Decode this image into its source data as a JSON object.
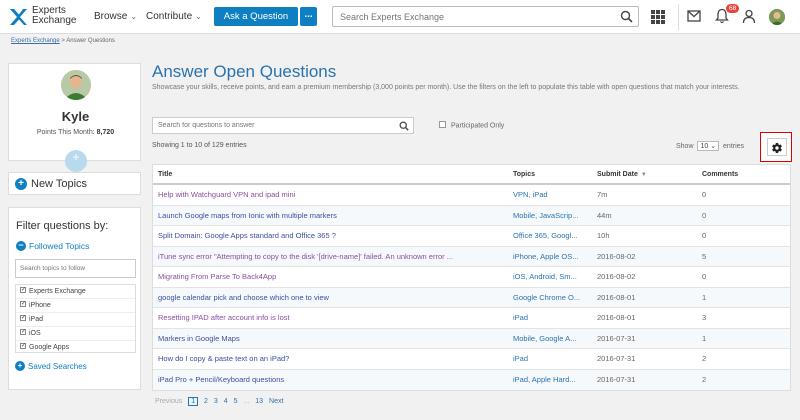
{
  "header": {
    "logo_line1": "Experts",
    "logo_line2": "Exchange",
    "nav_browse": "Browse",
    "nav_contribute": "Contribute",
    "ask_button": "Ask a Question",
    "more_button": "...",
    "search_placeholder": "Search Experts Exchange",
    "notification_count": "68",
    "accent_color": "#0e7fc1"
  },
  "breadcrumb": {
    "home": "Experts Exchange",
    "separator": ">",
    "current": "Answer Questions"
  },
  "profile": {
    "name": "Kyle",
    "points_label": "Points This Month:",
    "points_value": "8,720"
  },
  "sidebar": {
    "new_topics": "New Topics",
    "filter_title": "Filter questions by:",
    "followed_topics": "Followed Topics",
    "topic_search_placeholder": "Search topics to follow",
    "topics": [
      {
        "label": "Experts Exchange",
        "checked": true
      },
      {
        "label": "iPhone",
        "checked": true
      },
      {
        "label": "iPad",
        "checked": true
      },
      {
        "label": "iOS",
        "checked": true
      },
      {
        "label": "Google Apps",
        "checked": true
      }
    ],
    "saved_searches": "Saved Searches"
  },
  "main": {
    "title": "Answer Open Questions",
    "description": "Showcase your skills, receive points, and earn a premium membership (3,000 points per month). Use the filters on the left to populate this table with open questions that match your interests.",
    "search_placeholder": "Search for questions to answer",
    "participated_label": "Participated Only",
    "showing": "Showing 1 to 10 of 129 entries",
    "show_label": "Show",
    "show_value": "10",
    "entries_label": "entries"
  },
  "table": {
    "headers": {
      "title": "Title",
      "topics": "Topics",
      "submit_date": "Submit Date",
      "comments": "Comments"
    },
    "rows": [
      {
        "title": "Help with Watchguard VPN and ipad mini",
        "topics": "VPN, iPad",
        "date": "7m",
        "comments": "0"
      },
      {
        "title": "Launch Google maps from Ionic with multiple markers",
        "topics": "Mobile, JavaScrip...",
        "date": "44m",
        "comments": "0"
      },
      {
        "title": "Split Domain: Google Apps standard and Office 365 ?",
        "topics": "Office 365, Googl...",
        "date": "10h",
        "comments": "0"
      },
      {
        "title": "iTune sync error \"Attempting to copy to the disk '[drive-name]' failed. An unknown error ...",
        "topics": "iPhone, Apple OS...",
        "date": "2016-08-02",
        "comments": "5"
      },
      {
        "title": "Migrating From Parse To Back4App",
        "topics": "iOS, Android, Sm...",
        "date": "2016-08-02",
        "comments": "0"
      },
      {
        "title": "google calendar pick and choose which one to view",
        "topics": "Google Chrome O...",
        "date": "2016-08-01",
        "comments": "1"
      },
      {
        "title": "Resetting IPAD after account info is lost",
        "topics": "iPad",
        "date": "2016-08-01",
        "comments": "3"
      },
      {
        "title": "Markers in Google Maps",
        "topics": "Mobile, Google A...",
        "date": "2016-07-31",
        "comments": "1"
      },
      {
        "title": "How do I copy & paste text on an iPad?",
        "topics": "iPad",
        "date": "2016-07-31",
        "comments": "2"
      },
      {
        "title": "iPad Pro + Pencil/Keyboard questions",
        "topics": "iPad, Apple Hard...",
        "date": "2016-07-31",
        "comments": "2"
      }
    ]
  },
  "pagination": {
    "previous": "Previous",
    "pages": [
      "1",
      "2",
      "3",
      "4",
      "5"
    ],
    "ellipsis": "...",
    "last": "13",
    "next": "Next"
  }
}
